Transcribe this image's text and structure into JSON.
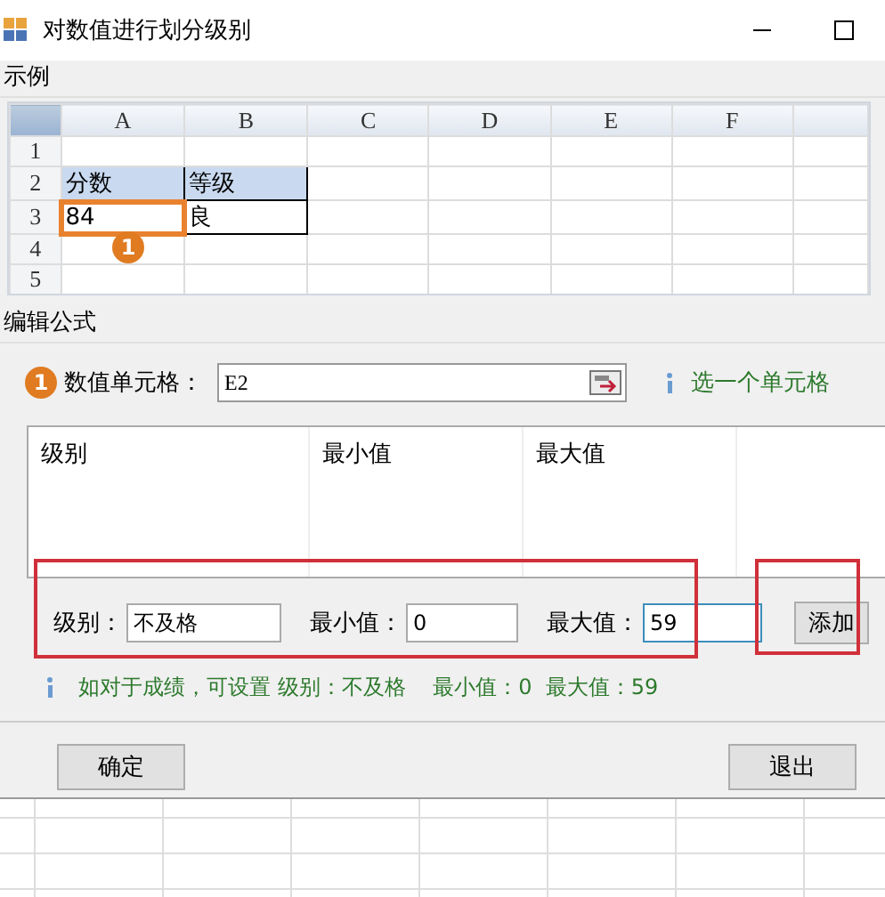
{
  "window": {
    "title": "对数值进行划分级别"
  },
  "example": {
    "label": "示例",
    "columns": [
      "A",
      "B",
      "C",
      "D",
      "E",
      "F"
    ],
    "badge": "1",
    "rows": [
      {
        "number": "1"
      },
      {
        "number": "2",
        "cells": [
          {
            "text": "分数",
            "kind": "header",
            "selected": false
          },
          {
            "text": "等级",
            "kind": "header",
            "selected": false
          }
        ]
      },
      {
        "number": "3",
        "cells": [
          {
            "text": "84",
            "kind": "value",
            "selected": true
          },
          {
            "text": "良",
            "kind": "value",
            "selected": false
          }
        ]
      },
      {
        "number": "4"
      },
      {
        "number": "5"
      }
    ]
  },
  "editor": {
    "label": "编辑公式",
    "badge": "1",
    "cell_label": "数值单元格：",
    "cell_value": "E2",
    "hint": "选一个单元格",
    "list_columns": [
      "级别",
      "最小值",
      "最大值"
    ],
    "fields": [
      {
        "label": "级别：",
        "value": "不及格",
        "focused": false
      },
      {
        "label": "最小值：",
        "value": "0",
        "focused": false
      },
      {
        "label": "最大值：",
        "value": "59",
        "focused": true
      }
    ],
    "add_button": "添加",
    "tip": "如对于成绩，可设置 级别：不及格    最小值：0  最大值：59"
  },
  "buttons": [
    {
      "label": "确定"
    },
    {
      "label": "退出"
    }
  ]
}
